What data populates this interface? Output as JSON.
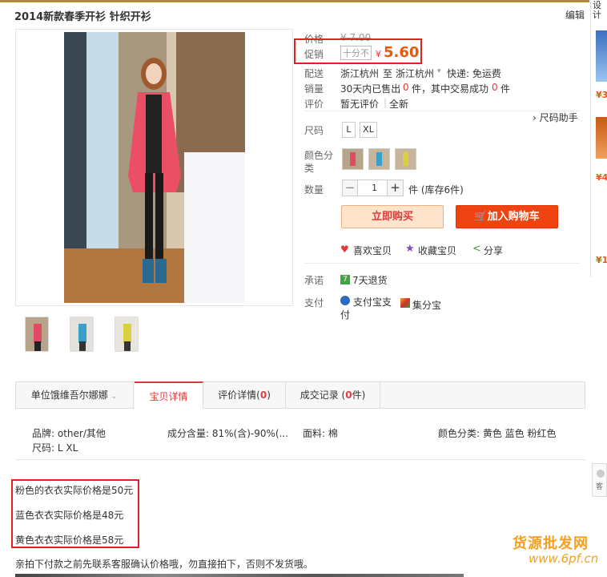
{
  "header": {
    "title": "2014新款春季开衫 针织开衫",
    "edit_label": "编辑"
  },
  "price": {
    "label": "价格",
    "old_price": "¥ 7.00",
    "promo_label": "促销",
    "discount_tag": "十分不",
    "currency": "¥",
    "new_price": "5.60"
  },
  "shipping": {
    "label": "配送",
    "from": "浙江杭州",
    "to_word": "至",
    "to": "浙江杭州",
    "express": "快递: 免运费"
  },
  "sales": {
    "label": "销量",
    "text_a": "30天内已售出",
    "sold": "0",
    "text_b": "件，其中交易成功",
    "success": "0",
    "text_c": "件"
  },
  "review": {
    "label": "评价",
    "none": "暂无评价",
    "all": "全新"
  },
  "size": {
    "label": "尺码",
    "help": "尺码助手",
    "options": [
      "L",
      "XL"
    ]
  },
  "color": {
    "label": "颜色分类"
  },
  "quantity": {
    "label": "数量",
    "minus": "−",
    "value": "1",
    "plus": "+",
    "unit_stock": "件 (库存6件)"
  },
  "actions": {
    "buy_now": "立即购买",
    "add_cart": "加入购物车",
    "like": "喜欢宝贝",
    "favorite": "收藏宝贝",
    "share": "分享"
  },
  "promise": {
    "label": "承诺",
    "badge": "7",
    "text": "7天退货"
  },
  "payment": {
    "label": "支付",
    "alipay": "支付宝支付",
    "jifen": "集分宝"
  },
  "tabs": [
    {
      "label": "单位饿维吾尔娜娜"
    },
    {
      "label": "宝贝详情"
    },
    {
      "label": "评价详情",
      "count": "0"
    },
    {
      "label": "成交记录",
      "count": "0",
      "unit": "件"
    }
  ],
  "attributes": {
    "brand": "品牌: other/其他",
    "composition": "成分含量: 81%(含)-90%(...",
    "material": "面料: 棉",
    "colors": "颜色分类: 黄色 蓝色 粉红色",
    "sizes": "尺码: L XL"
  },
  "notes": [
    "粉色的衣衣实际价格是50元",
    "蓝色衣衣实际价格是48元",
    "黄色衣衣实际价格是58元"
  ],
  "footnote": "亲拍下付款之前先联系客服确认价格哦，勿直接拍下，否则不发货哦。",
  "rail": {
    "top_text": "设计",
    "prices": [
      "¥3",
      "¥4",
      "¥1"
    ],
    "side_label": "客"
  },
  "watermark": {
    "line1": "货源批发网",
    "line2": "www.6pf.cn"
  }
}
